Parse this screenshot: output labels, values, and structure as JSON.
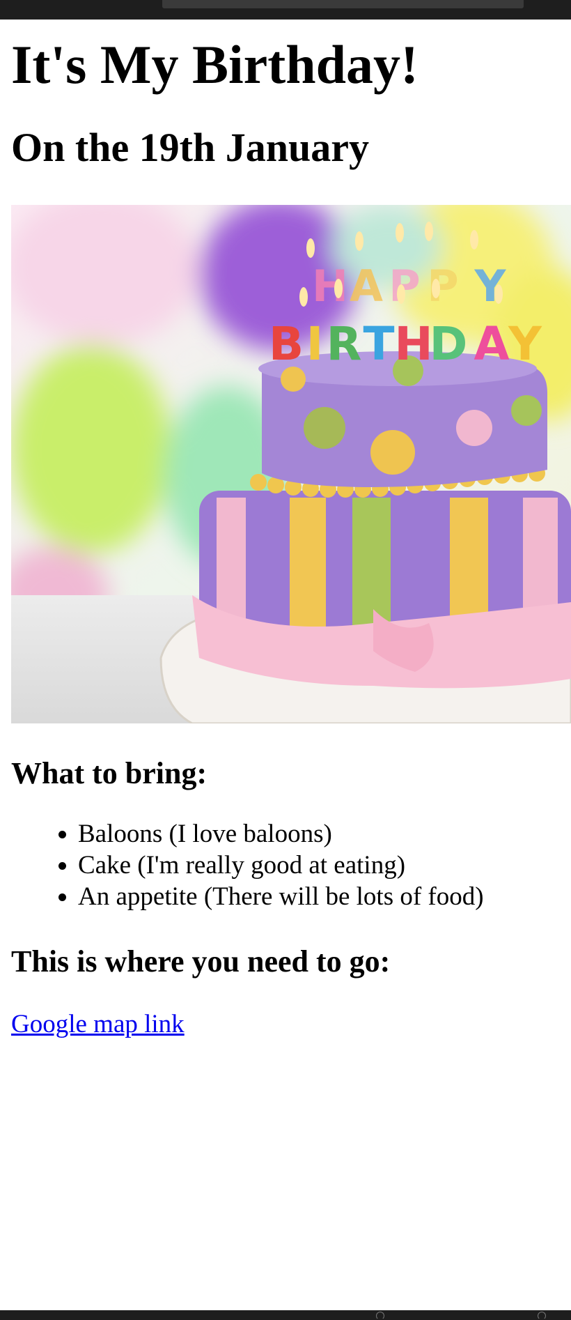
{
  "page": {
    "title": "It's My Birthday!",
    "date_heading": "On the 19th January",
    "bring_heading": "What to bring:",
    "bring_items": [
      "Baloons (I love baloons)",
      "Cake (I'm really good at eating)",
      "An appetite (There will be lots of food)"
    ],
    "where_heading": "This is where you need to go:",
    "map_link": "Google map link"
  },
  "image": {
    "cake_text_top": "HAPPY",
    "cake_text_bottom": "BIRTHDAY"
  },
  "colors": {
    "link": "#0000ee",
    "browser_chrome": "#1e1e1e"
  }
}
